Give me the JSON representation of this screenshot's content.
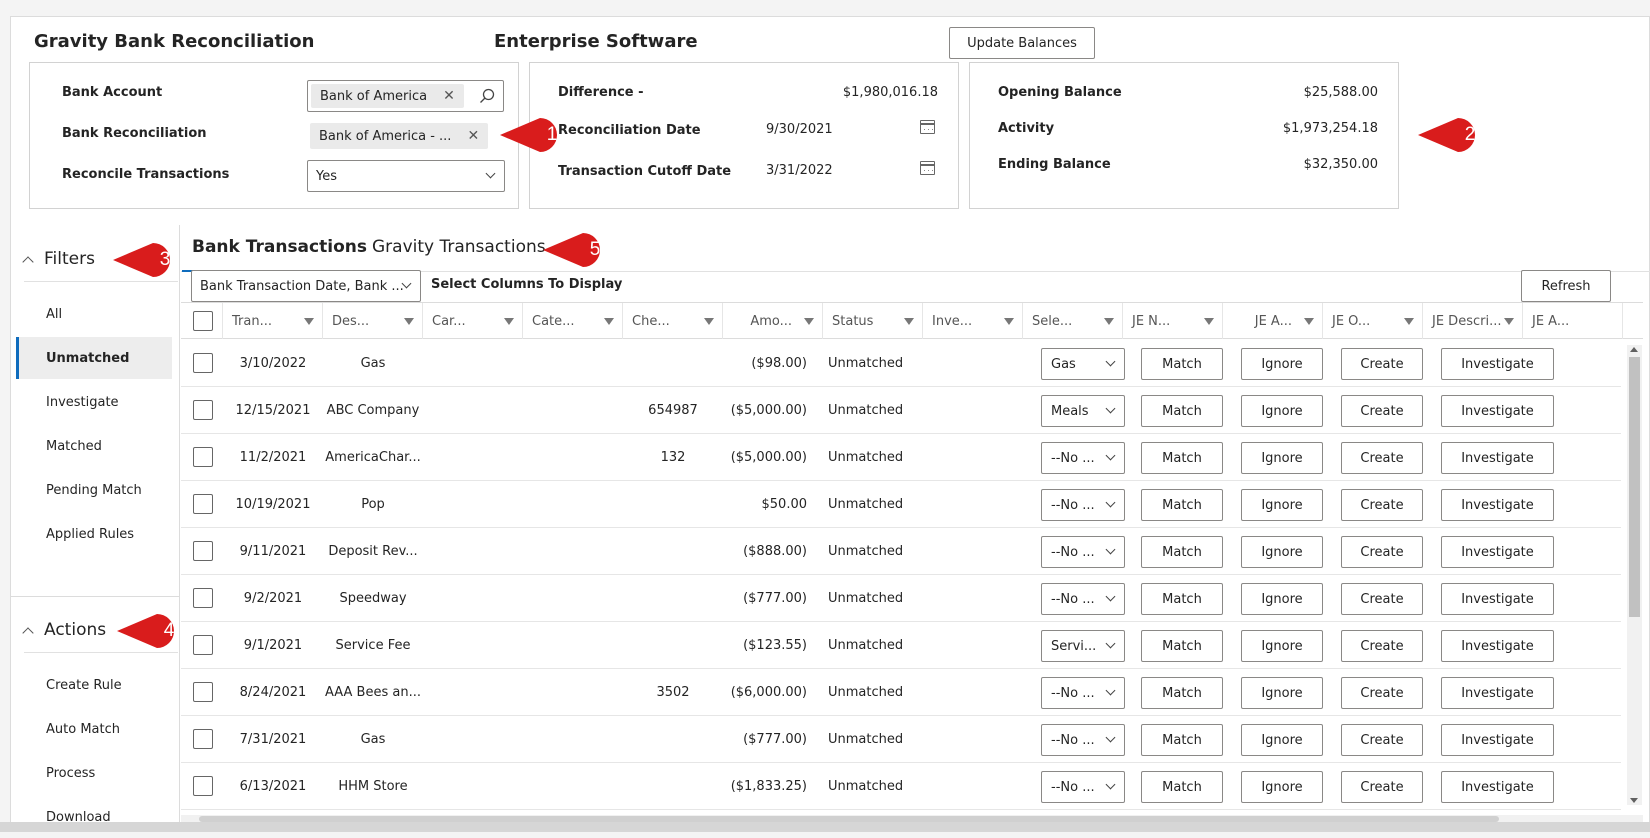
{
  "header": {
    "app_title": "Gravity Bank Reconciliation",
    "company": "Enterprise Software",
    "update_button": "Update Balances"
  },
  "account_panel": {
    "bank_account_label": "Bank Account",
    "bank_account_value": "Bank of America",
    "bank_reconciliation_label": "Bank Reconciliation",
    "bank_reconciliation_value": "Bank of America - ...",
    "reconcile_label": "Reconcile Transactions",
    "reconcile_value": "Yes"
  },
  "dates_panel": {
    "difference_label": "Difference -",
    "difference_value": "$1,980,016.18",
    "recon_date_label": "Reconciliation Date",
    "recon_date_value": "9/30/2021",
    "cutoff_label": "Transaction Cutoff Date",
    "cutoff_value": "3/31/2022"
  },
  "balance_panel": {
    "opening_label": "Opening Balance",
    "opening_value": "$25,588.00",
    "activity_label": "Activity",
    "activity_value": "$1,973,254.18",
    "ending_label": "Ending Balance",
    "ending_value": "$32,350.00"
  },
  "badges": [
    "1",
    "2",
    "3",
    "4",
    "5"
  ],
  "badge_color": "#d91c1c",
  "accent_color": "#0f6cbd",
  "filters": {
    "title": "Filters",
    "items": [
      "All",
      "Unmatched",
      "Investigate",
      "Matched",
      "Pending Match",
      "Applied Rules"
    ],
    "selected": "Unmatched"
  },
  "actions": {
    "title": "Actions",
    "items": [
      "Create Rule",
      "Auto Match",
      "Process",
      "Download"
    ]
  },
  "tabs": [
    "Bank Transactions",
    "Gravity Transactions"
  ],
  "active_tab": "Bank Transactions",
  "sort_select": "Bank Transaction Date, Bank ...",
  "select_columns_label": "Select Columns To Display",
  "refresh_button": "Refresh",
  "columns": [
    "Tran...",
    "Des...",
    "Car...",
    "Cate...",
    "Che...",
    "Amo...",
    "Status",
    "Inve...",
    "Sele...",
    "JE N...",
    "JE A...",
    "JE O...",
    "JE Descri...",
    "JE A..."
  ],
  "row_buttons": {
    "match": "Match",
    "ignore": "Ignore",
    "create": "Create",
    "investigate": "Investigate"
  },
  "rows": [
    {
      "date": "3/10/2022",
      "desc": "Gas",
      "check": "",
      "amount": "($98.00)",
      "status": "Unmatched",
      "select": "Gas"
    },
    {
      "date": "12/15/2021",
      "desc": "ABC Company",
      "check": "654987",
      "amount": "($5,000.00)",
      "status": "Unmatched",
      "select": "Meals"
    },
    {
      "date": "11/2/2021",
      "desc": "AmericaChar...",
      "check": "132",
      "amount": "($5,000.00)",
      "status": "Unmatched",
      "select": "--No ..."
    },
    {
      "date": "10/19/2021",
      "desc": "Pop",
      "check": "",
      "amount": "$50.00",
      "status": "Unmatched",
      "select": "--No ..."
    },
    {
      "date": "9/11/2021",
      "desc": "Deposit Rev...",
      "check": "",
      "amount": "($888.00)",
      "status": "Unmatched",
      "select": "--No ..."
    },
    {
      "date": "9/2/2021",
      "desc": "Speedway",
      "check": "",
      "amount": "($777.00)",
      "status": "Unmatched",
      "select": "--No ..."
    },
    {
      "date": "9/1/2021",
      "desc": "Service Fee",
      "check": "",
      "amount": "($123.55)",
      "status": "Unmatched",
      "select": "Servi..."
    },
    {
      "date": "8/24/2021",
      "desc": "AAA Bees an...",
      "check": "3502",
      "amount": "($6,000.00)",
      "status": "Unmatched",
      "select": "--No ..."
    },
    {
      "date": "7/31/2021",
      "desc": "Gas",
      "check": "",
      "amount": "($777.00)",
      "status": "Unmatched",
      "select": "--No ..."
    },
    {
      "date": "6/13/2021",
      "desc": "HHM Store",
      "check": "",
      "amount": "($1,833.25)",
      "status": "Unmatched",
      "select": "--No ..."
    }
  ]
}
